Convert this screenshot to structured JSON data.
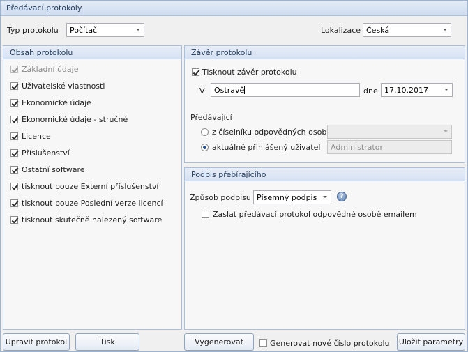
{
  "window": {
    "title": "Předávací protokoly"
  },
  "top": {
    "type_label": "Typ protokolu",
    "type_value": "Počítač",
    "locale_label": "Lokalizace",
    "locale_value": "Česká"
  },
  "content_panel": {
    "header": "Obsah protokolu",
    "items": [
      {
        "label": "Základní údaje",
        "checked": true,
        "disabled": true
      },
      {
        "label": "Uživatelské vlastnosti",
        "checked": true,
        "disabled": false
      },
      {
        "label": "Ekonomické údaje",
        "checked": true,
        "disabled": false
      },
      {
        "label": "Ekonomické údaje - stručné",
        "checked": true,
        "disabled": false
      },
      {
        "label": "Licence",
        "checked": true,
        "disabled": false
      },
      {
        "label": "Příslušenství",
        "checked": true,
        "disabled": false
      },
      {
        "label": "Ostatní software",
        "checked": true,
        "disabled": false
      },
      {
        "label": "tisknout pouze Externí příslušenství",
        "checked": true,
        "disabled": false
      },
      {
        "label": "tisknout pouze Poslední verze licencí",
        "checked": true,
        "disabled": false
      },
      {
        "label": "tisknout skutečně nalezený software",
        "checked": true,
        "disabled": false
      }
    ]
  },
  "conclusion_panel": {
    "header": "Závěr protokolu",
    "print_conclusion_label": "Tisknout závěr protokolu",
    "print_conclusion_checked": true,
    "place_prefix": "V",
    "place_value": "Ostravě",
    "date_label": "dne :",
    "date_value": "17.10.2017",
    "handover_label": "Předávající",
    "radio_list_label": "z  číselníku odpovědných osob",
    "radio_list_value": "",
    "radio_current_label": "aktuálně přihlášený uživatel",
    "radio_current_value": "Administrator",
    "selected": "current"
  },
  "signature_panel": {
    "header": "Podpis přebírajícího",
    "method_label": "Způsob podpisu",
    "method_value": "Písemný podpis",
    "email_label": "Zaslat předávací protokol odpovědné osobě emailem",
    "email_checked": false
  },
  "footer": {
    "edit_button": "Upravit protokol",
    "print_button": "Tisk",
    "generate_button": "Vygenerovat",
    "new_number_label": "Generovat nové číslo protokolu",
    "new_number_checked": false,
    "save_button": "Uložit parametry"
  }
}
